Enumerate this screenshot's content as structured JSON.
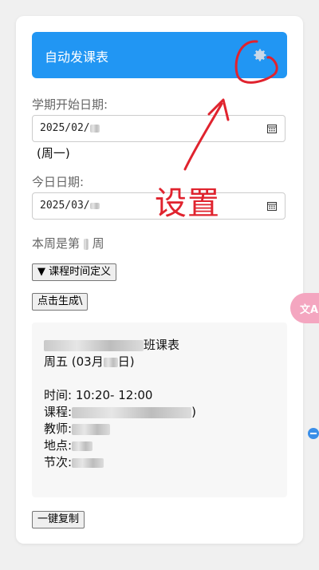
{
  "header": {
    "title": "自动发课表",
    "settings_icon": "gear-icon"
  },
  "semester": {
    "label": "学期开始日期:",
    "date_value": "2025/02/",
    "weekday": "(周一)"
  },
  "today": {
    "label": "今日日期:",
    "date_value": "2025/03/"
  },
  "week": {
    "prefix": "本周是第",
    "suffix": "周"
  },
  "buttons": {
    "class_time": "▼ 课程时间定义",
    "generate": "点击生成\\",
    "copy": "一键复制"
  },
  "schedule": {
    "title_suffix": "班课表",
    "day_prefix": "周五 (03月",
    "day_suffix": "日)",
    "time": "时间: 10:20- 12:00",
    "course_prefix": "课程:",
    "course_suffix": ")",
    "teacher_prefix": "教师:",
    "place_prefix": "地点:",
    "period_prefix": "节次:"
  },
  "annotation": {
    "text": "设置",
    "color": "#e0232e"
  },
  "translate": {
    "label": "文A"
  },
  "colors": {
    "accent": "#2196f3",
    "annotation": "#e0232e"
  }
}
